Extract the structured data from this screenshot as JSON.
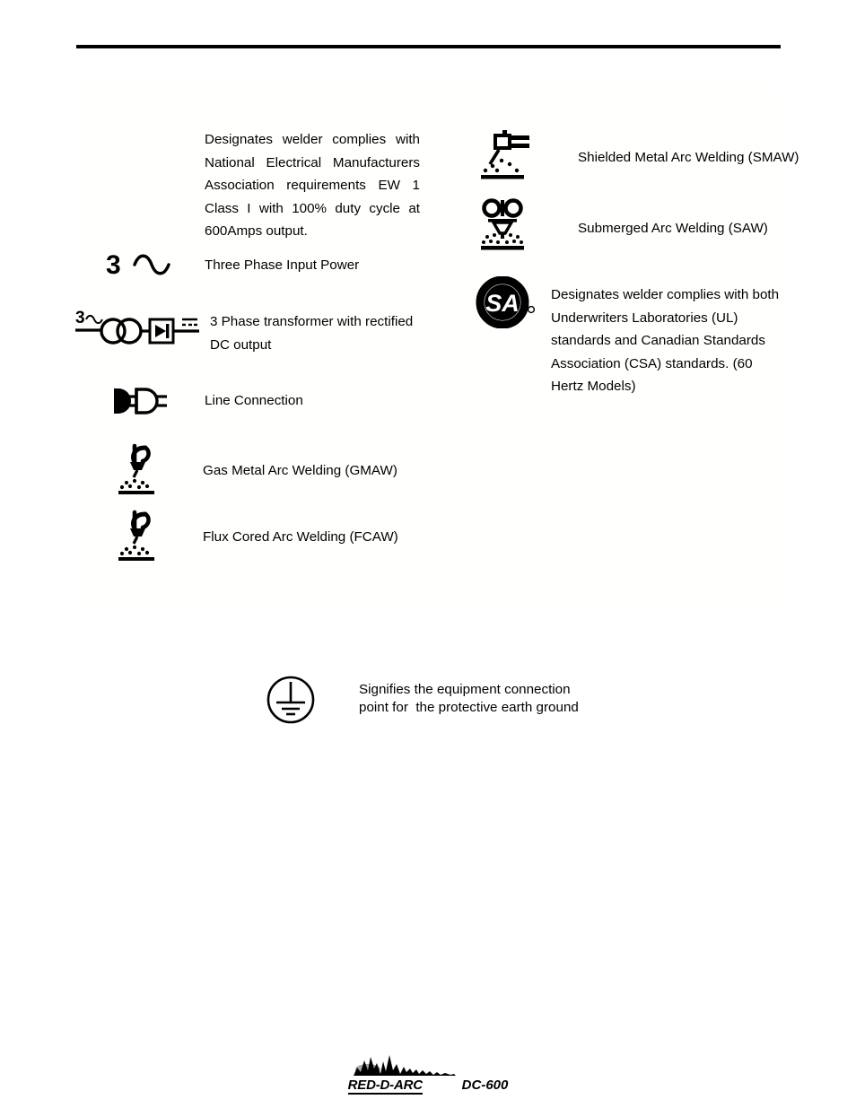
{
  "page": {
    "background_color": "#ffffff",
    "ink_color": "#000000"
  },
  "header": {
    "rule": "horizontal-rule"
  },
  "left_column": {
    "items": [
      {
        "symbol": "nema-text-only",
        "icon_name": "no-icon",
        "text": "Designates welder complies with National Electrical Manufacturers Association requirements EW 1 Class I with 100% duty cycle at 600Amps output."
      },
      {
        "symbol": "three-phase-input",
        "icon_name": "three-phase-sine-icon",
        "icon_digit": "3",
        "text": "Three Phase Input Power"
      },
      {
        "symbol": "three-phase-transformer-rectified",
        "icon_name": "transformer-rectifier-icon",
        "icon_digit": "3~",
        "text": "3 Phase transformer with rectified DC output"
      },
      {
        "symbol": "line-connection",
        "icon_name": "plug-connection-icon",
        "text": "Line Connection"
      },
      {
        "symbol": "gmaw",
        "icon_name": "gmaw-torch-icon",
        "text": "Gas Metal Arc Welding (GMAW)"
      },
      {
        "symbol": "fcaw",
        "icon_name": "fcaw-torch-icon",
        "text": "Flux Cored Arc Welding (FCAW)"
      }
    ]
  },
  "right_column": {
    "items": [
      {
        "symbol": "smaw",
        "icon_name": "smaw-electrode-holder-icon",
        "text": "Shielded Metal Arc Welding (SMAW)"
      },
      {
        "symbol": "saw",
        "icon_name": "saw-hopper-icon",
        "text": "Submerged Arc Welding (SAW)"
      },
      {
        "symbol": "csa-ul",
        "icon_name": "csa-certification-logo",
        "logo_text": "CSA",
        "text": "Designates welder complies with both Underwriters Laboratories (UL) standards and Canadian Standards Association (CSA) standards. (60 Hertz Models)"
      }
    ]
  },
  "ground_note": {
    "symbol": "protective-earth-ground",
    "icon_name": "protective-earth-ground-icon",
    "line1": "Signifies the equipment connection",
    "line2": "point for  the protective earth ground"
  },
  "footer": {
    "brand": "RED-D-ARC",
    "model": "DC-600",
    "logo_name": "red-d-arc-mountain-logo"
  }
}
